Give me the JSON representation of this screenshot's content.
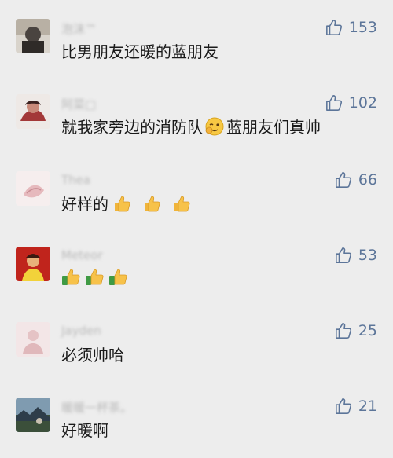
{
  "comments": [
    {
      "username": "泡沫™",
      "text": "比男朋友还暖的蓝朋友",
      "likes": "153",
      "avatar_color": "#5a5650",
      "inline_emoji": ""
    },
    {
      "username": "阿菜□",
      "text_before": "就我家旁边的消防队",
      "inline_emoji": "wink-ok-emoji",
      "text_after": "蓝朋友们真帅",
      "likes": "102",
      "avatar_color": "#9b3b3b"
    },
    {
      "username": "Thea",
      "text": "好样的",
      "emoji": "thumbs-up-emoji",
      "emoji_count": 3,
      "likes": "66",
      "avatar_color": "#f0d6d8"
    },
    {
      "username": "Meteor",
      "text": "",
      "emoji": "thumbs-up-emoji",
      "emoji_count": 3,
      "likes": "53",
      "avatar_color": "#c0241c"
    },
    {
      "username": "Jayden",
      "text": "必须帅哈",
      "likes": "25",
      "avatar_color": "#efdbdc"
    },
    {
      "username": "暖暖一杯茶。",
      "text": "好暖啊",
      "likes": "21",
      "avatar_color": "#3d5a6e"
    }
  ],
  "colors": {
    "background": "#ededed",
    "text": "#1a1a1a",
    "likes": "#5c7599",
    "username": "#b9b9b9"
  },
  "icons": {
    "like": "thumbs-up-outline-icon"
  }
}
